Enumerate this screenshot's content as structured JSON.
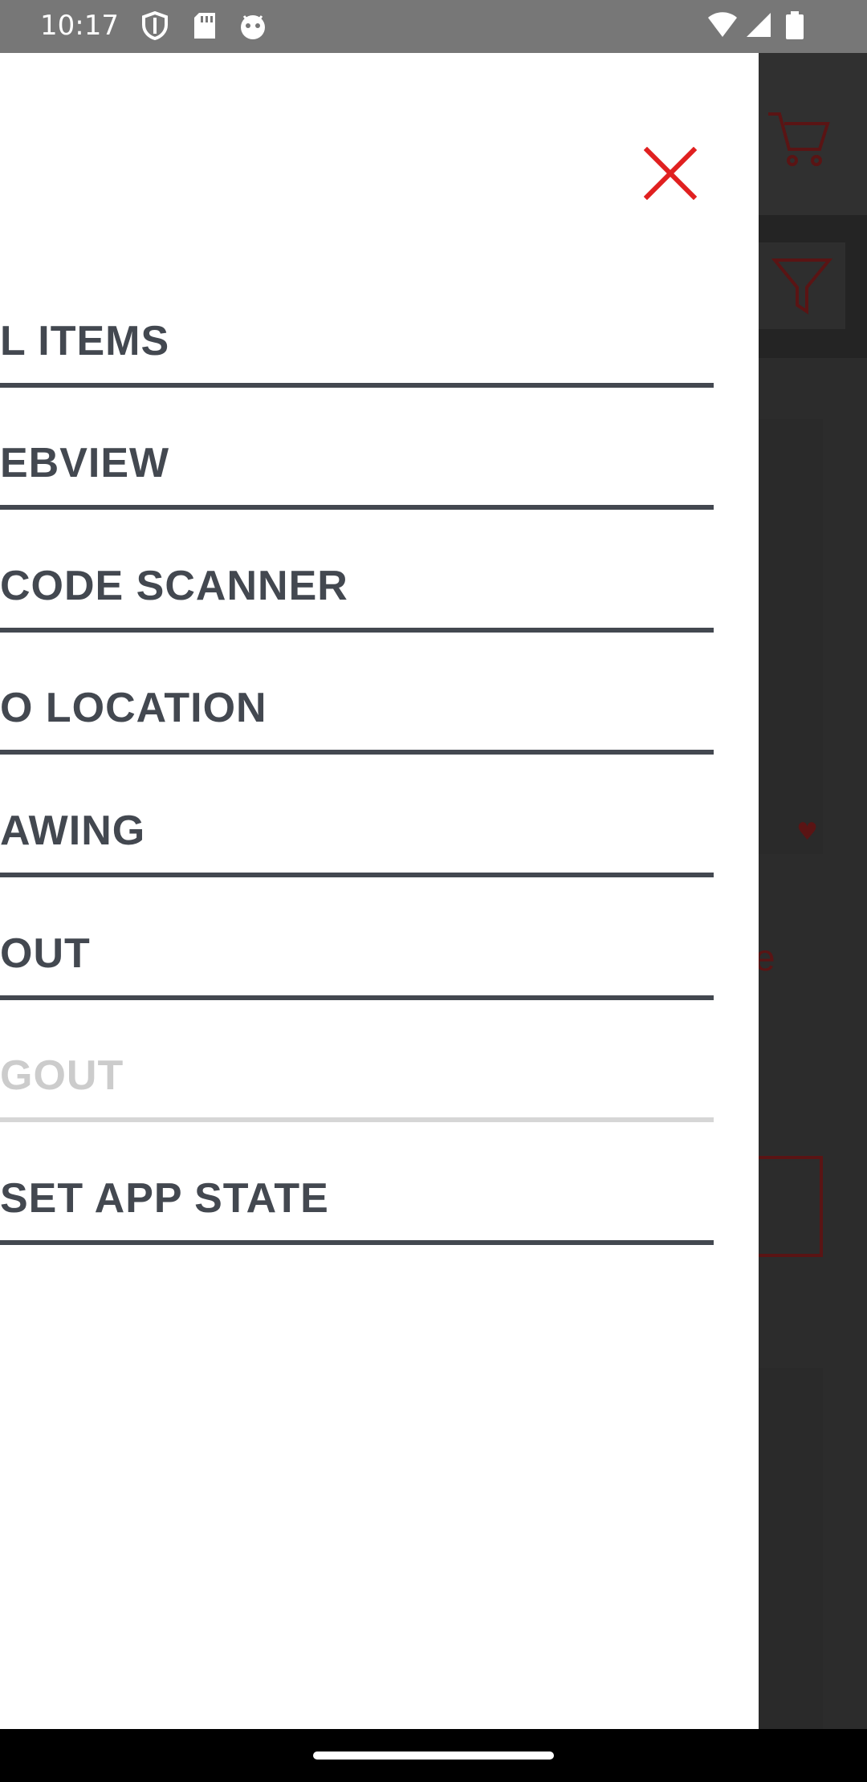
{
  "status_bar": {
    "time": "10:17",
    "left_icons": [
      "shield-icon",
      "sd-card-icon",
      "android-debug-icon"
    ],
    "right_icons": [
      "wifi-icon",
      "signal-icon",
      "battery-icon"
    ]
  },
  "drawer": {
    "close_icon": "close-icon",
    "close_color": "#e02020",
    "menu_items": [
      {
        "label": "ALL ITEMS",
        "visible_text": "L ITEMS",
        "enabled": true
      },
      {
        "label": "WEBVIEW",
        "visible_text": "EBVIEW",
        "enabled": true
      },
      {
        "label": "QR CODE SCANNER",
        "visible_text": " CODE SCANNER",
        "enabled": true
      },
      {
        "label": "GEO LOCATION",
        "visible_text": "O LOCATION",
        "enabled": true
      },
      {
        "label": "DRAWING",
        "visible_text": "AWING",
        "enabled": true
      },
      {
        "label": "ABOUT",
        "visible_text": "OUT",
        "enabled": true
      },
      {
        "label": "LOGOUT",
        "visible_text": "GOUT",
        "enabled": false
      },
      {
        "label": "RESET APP STATE",
        "visible_text": "SET APP STATE",
        "enabled": true
      }
    ]
  },
  "background_app": {
    "cart_icon": "cart-icon",
    "filter_icon": "filter-icon",
    "partial_text": "e"
  },
  "colors": {
    "menu_text": "#434850",
    "menu_disabled": "#cccccc",
    "accent_red": "#e02020",
    "status_bar": "#777777"
  }
}
